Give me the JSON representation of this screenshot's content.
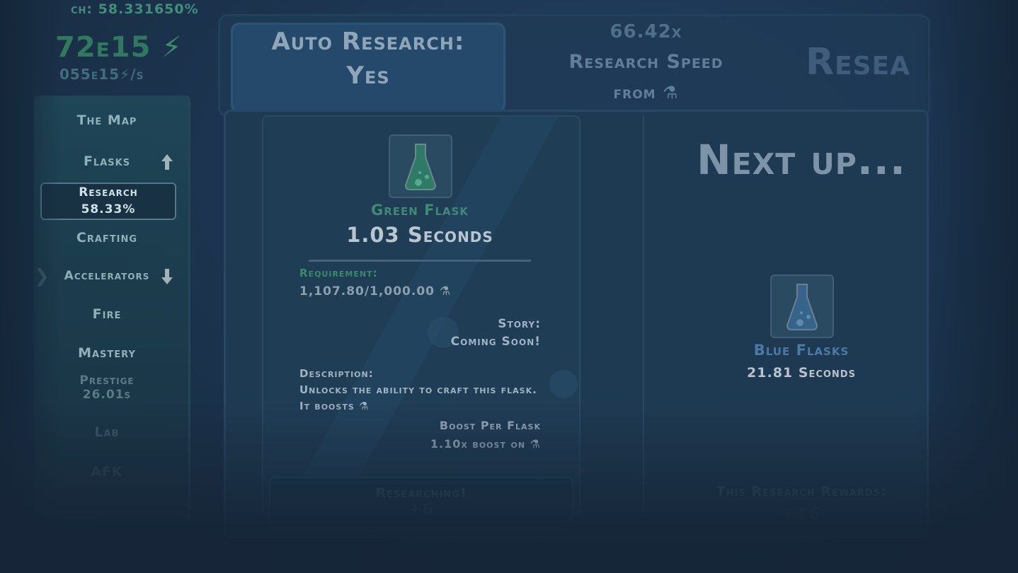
{
  "header": {
    "research_percent_top": "ch: 58.331650%",
    "energy_value": "72e15",
    "energy_rate": "055e15",
    "energy_rate_suffix": "/s"
  },
  "sidebar": {
    "items": [
      {
        "label": "The Map"
      },
      {
        "label": "Flasks"
      },
      {
        "label": "Research",
        "sub": "58.33%"
      },
      {
        "label": "Crafting"
      },
      {
        "label": "Accelerators"
      },
      {
        "label": "Fire"
      },
      {
        "label": "Mastery"
      },
      {
        "label": "Prestige",
        "sub": "26.01s"
      },
      {
        "label": "Lab"
      },
      {
        "label": "AFK"
      }
    ]
  },
  "top": {
    "auto_research_line1": "Auto Research:",
    "auto_research_line2": "Yes",
    "speed_multiplier": "66.42x",
    "speed_label": "Research Speed",
    "speed_from": "from",
    "research_title": "Resea"
  },
  "current": {
    "flask_name": "Green Flask",
    "time": "1.03 Seconds",
    "requirement_label": "Requirement:",
    "requirement_value": "1,107.80/1,000.00",
    "story_label": "Story:",
    "story_value": "Coming Soon!",
    "description_label": "Description:",
    "description_line1": "Unlocks the ability to craft this flask.",
    "description_line2": "It boosts",
    "boost_label": "Boost Per Flask",
    "boost_value": "1.10x boost on",
    "button_label": "Researching!",
    "button_reward": "+6"
  },
  "next": {
    "title": "Next up...",
    "flask_name": "Blue Flasks",
    "time": "21.81 Seconds",
    "rewards_label": "This Research Rewards:",
    "rewards_value": "+16"
  },
  "colors": {
    "green_flask": "#2f8a70",
    "blue_flask": "#3d6f9a",
    "energy": "#3a8f6a"
  }
}
